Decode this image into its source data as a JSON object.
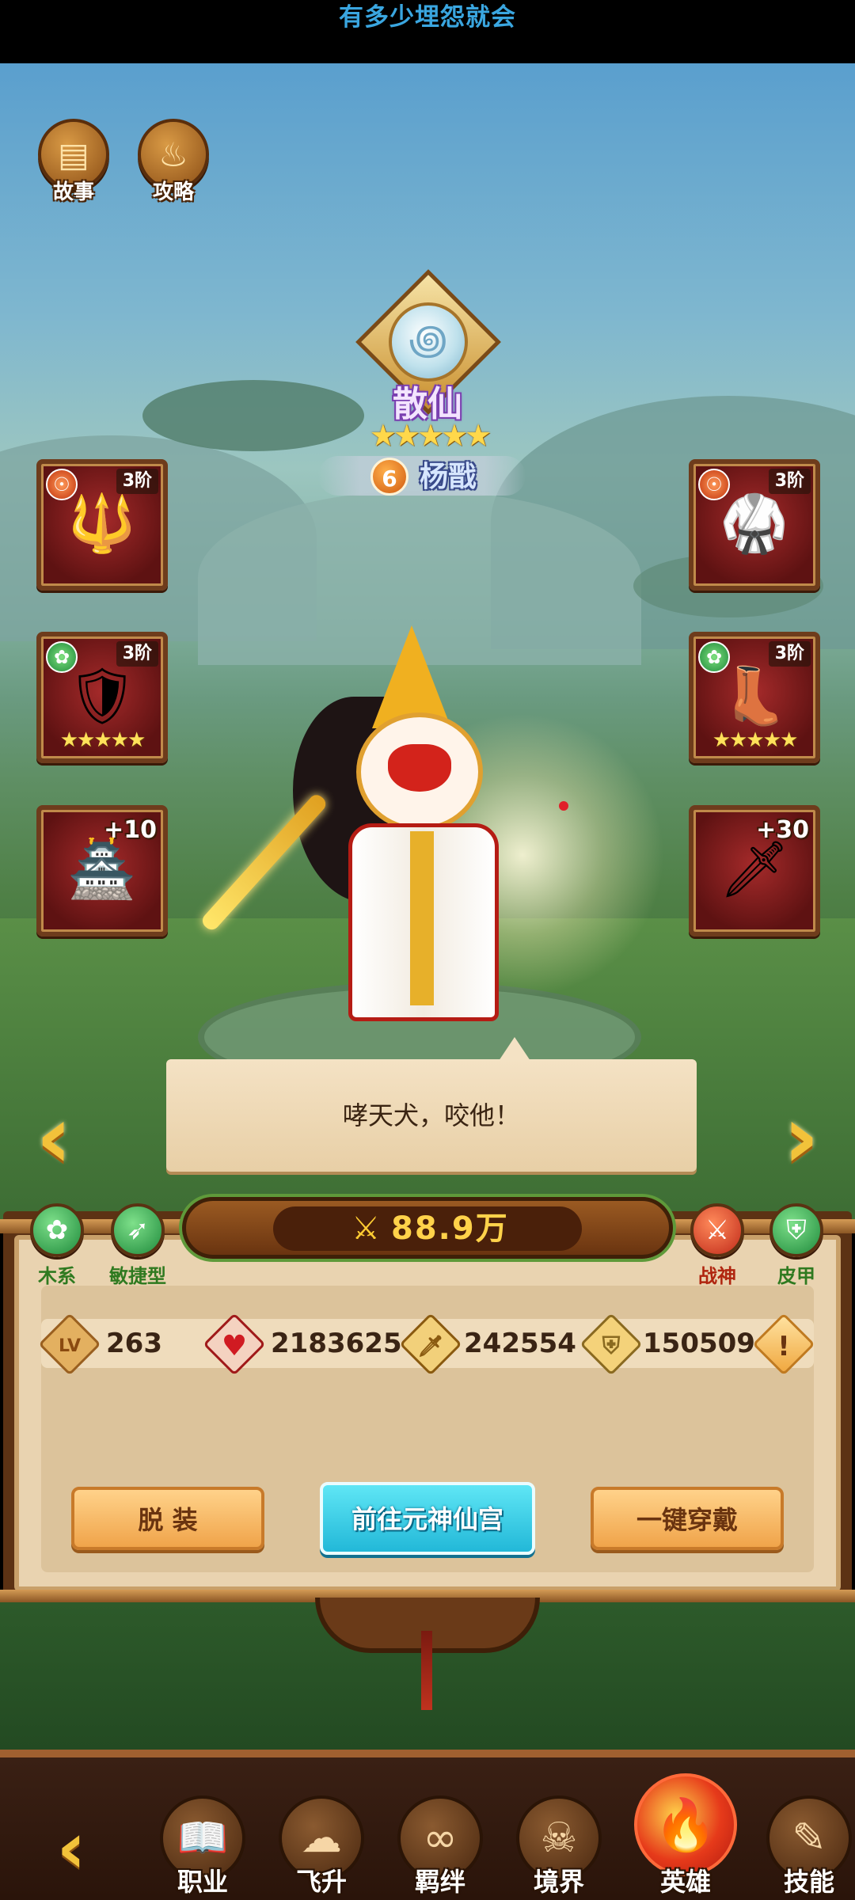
{
  "topbar": {
    "title": "有多少埋怨就会"
  },
  "top_buttons": [
    {
      "label": "故事",
      "icon": "book-stack-icon",
      "glyph": "▤"
    },
    {
      "label": "攻略",
      "icon": "flame-icon",
      "glyph": "♨"
    }
  ],
  "hero": {
    "rank_title": "散仙",
    "stars": "★★★★★",
    "star_count": 5,
    "level_badge": "6",
    "name": "杨戬"
  },
  "equipment": {
    "left": [
      {
        "type": "weapon",
        "badge": "☉",
        "tier": "3阶",
        "item": "🔱"
      },
      {
        "type": "armor",
        "badge": "✿",
        "tier": "3阶",
        "item": "🛡",
        "stars": "★★★★★"
      },
      {
        "type": "treasure",
        "plus": "+10",
        "item": "🏯"
      }
    ],
    "right": [
      {
        "type": "chest",
        "badge": "☉",
        "tier": "3阶",
        "item": "🥋"
      },
      {
        "type": "boots",
        "badge": "✿",
        "tier": "3阶",
        "item": "👢",
        "stars": "★★★★★"
      },
      {
        "type": "blade",
        "plus": "+30",
        "item": "🗡"
      }
    ]
  },
  "speech": {
    "text": "哮天犬，咬他！"
  },
  "nav_arrows": {
    "left": "‹",
    "right": "›"
  },
  "traits_left": [
    {
      "label": "木系",
      "glyph": "✿",
      "color": "green"
    },
    {
      "label": "敏捷型",
      "glyph": "➶",
      "color": "green"
    }
  ],
  "traits_right": [
    {
      "label": "战神",
      "glyph": "⚔",
      "color": "red"
    },
    {
      "label": "皮甲",
      "glyph": "⛨",
      "color": "green"
    }
  ],
  "power": {
    "icon": "⚔",
    "value": "88.9万"
  },
  "stats": [
    {
      "name": "level",
      "icon": "LV",
      "value": "263",
      "color": "#c98a3a"
    },
    {
      "name": "hp",
      "icon": "♥",
      "value": "2183625",
      "color": "#c0262a"
    },
    {
      "name": "attack",
      "icon": "🗡",
      "value": "242554",
      "color": "#b07a2a"
    },
    {
      "name": "defense",
      "icon": "⛨",
      "value": "150509",
      "color": "#b08a3a"
    }
  ],
  "stat_info": {
    "icon": "!"
  },
  "actions": {
    "unequip": "脱 装",
    "goto_palace": "前往元神仙宫",
    "equip_all": "一键穿戴"
  },
  "bottom_nav": {
    "back_glyph": "‹",
    "items": [
      {
        "label": "职业",
        "glyph": "📖",
        "active": false
      },
      {
        "label": "飞升",
        "glyph": "☁",
        "active": false
      },
      {
        "label": "羁绊",
        "glyph": "∞",
        "active": false
      },
      {
        "label": "境界",
        "glyph": "☠",
        "active": false
      },
      {
        "label": "英雄",
        "glyph": "🔥",
        "active": true
      },
      {
        "label": "技能",
        "glyph": "✎",
        "active": false
      }
    ]
  }
}
